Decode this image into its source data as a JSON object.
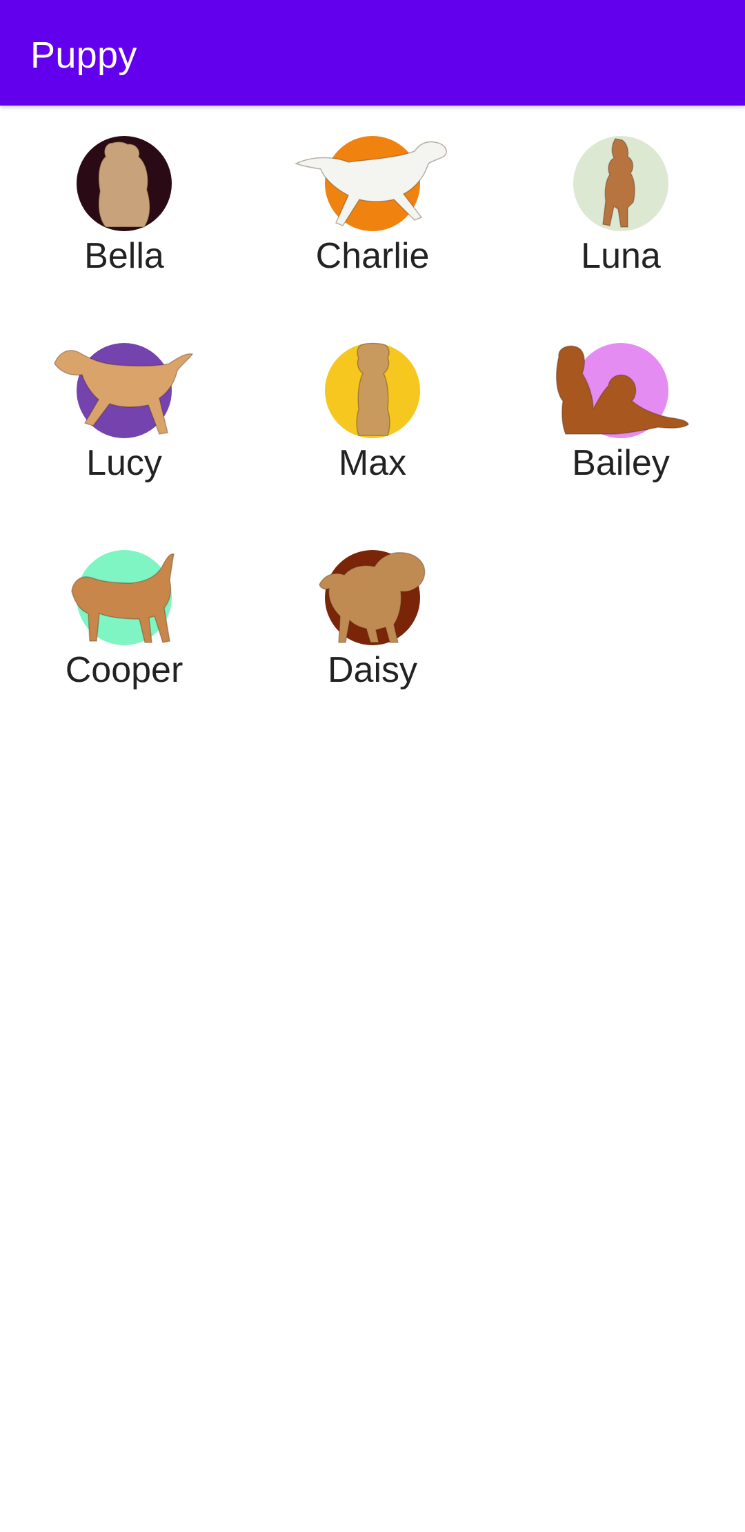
{
  "app": {
    "title": "Puppy",
    "colors": {
      "appbar": "#6200EE",
      "appbar_text": "#FFFFFF",
      "name_text": "#222222",
      "background": "#FFFFFF"
    }
  },
  "puppies": [
    {
      "name": "Bella",
      "circle_color": "#2A0A14",
      "coat": "#C7A27A",
      "icon": "dog-sitting-back-icon"
    },
    {
      "name": "Charlie",
      "circle_color": "#F0820F",
      "coat": "#F4F4F0",
      "icon": "dog-running-icon"
    },
    {
      "name": "Luna",
      "circle_color": "#DDE8D3",
      "coat": "#B8743E",
      "icon": "dog-walking-front-icon"
    },
    {
      "name": "Lucy",
      "circle_color": "#7443AE",
      "coat": "#D9A36A",
      "icon": "dog-running-icon"
    },
    {
      "name": "Max",
      "circle_color": "#F6C71F",
      "coat": "#C99A5E",
      "icon": "dog-sitting-front-icon"
    },
    {
      "name": "Bailey",
      "circle_color": "#E48CF2",
      "coat": "#A8581F",
      "icon": "two-dogs-lying-icon"
    },
    {
      "name": "Cooper",
      "circle_color": "#7FF5C4",
      "coat": "#C9864A",
      "icon": "dog-walking-side-icon"
    },
    {
      "name": "Daisy",
      "circle_color": "#7A2408",
      "coat": "#C08B52",
      "icon": "dog-standing-icon"
    }
  ]
}
